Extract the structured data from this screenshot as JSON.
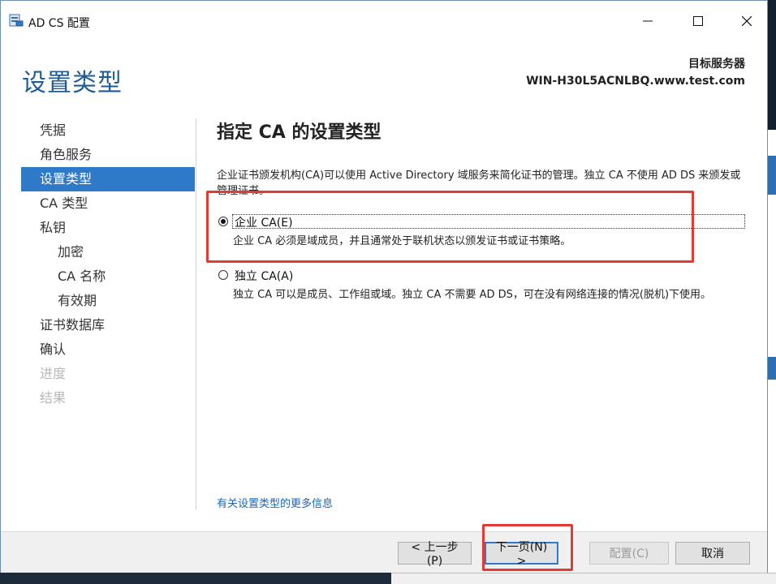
{
  "window": {
    "title": "AD CS 配置",
    "controls": {
      "minimize_icon": "minimize-icon",
      "maximize_icon": "maximize-icon",
      "close_icon": "close-icon"
    }
  },
  "header": {
    "page_title": "设置类型",
    "target_label": "目标服务器",
    "target_name": "WIN-H30L5ACNLBQ.www.test.com"
  },
  "nav": {
    "items": [
      {
        "label": "凭据",
        "state": "normal"
      },
      {
        "label": "角色服务",
        "state": "normal"
      },
      {
        "label": "设置类型",
        "state": "active"
      },
      {
        "label": "CA 类型",
        "state": "normal"
      },
      {
        "label": "私钥",
        "state": "normal"
      },
      {
        "label": "加密",
        "state": "sub"
      },
      {
        "label": "CA 名称",
        "state": "sub"
      },
      {
        "label": "有效期",
        "state": "sub"
      },
      {
        "label": "证书数据库",
        "state": "normal"
      },
      {
        "label": "确认",
        "state": "normal"
      },
      {
        "label": "进度",
        "state": "disabled"
      },
      {
        "label": "结果",
        "state": "disabled"
      }
    ]
  },
  "main": {
    "section_title": "指定 CA 的设置类型",
    "intro": "企业证书颁发机构(CA)可以使用 Active Directory 域服务来简化证书的管理。独立 CA 不使用 AD DS 来颁发或管理证书。",
    "options": [
      {
        "label": "企业 CA(E)",
        "checked": true,
        "description": "企业 CA 必须是域成员，并且通常处于联机状态以颁发证书或证书策略。"
      },
      {
        "label": "独立 CA(A)",
        "checked": false,
        "description": "独立 CA 可以是成员、工作组或域。独立 CA 不需要 AD DS，可在没有网络连接的情况(脱机)下使用。"
      }
    ],
    "more_info_link": "有关设置类型的更多信息"
  },
  "footer": {
    "prev": "< 上一步(P)",
    "next": "下一页(N) >",
    "configure": "配置(C)",
    "cancel": "取消"
  },
  "colors": {
    "accent": "#2f7ac8",
    "title_blue": "#1f5b94",
    "annotation_red": "#e53935",
    "link": "#1e64b4"
  }
}
